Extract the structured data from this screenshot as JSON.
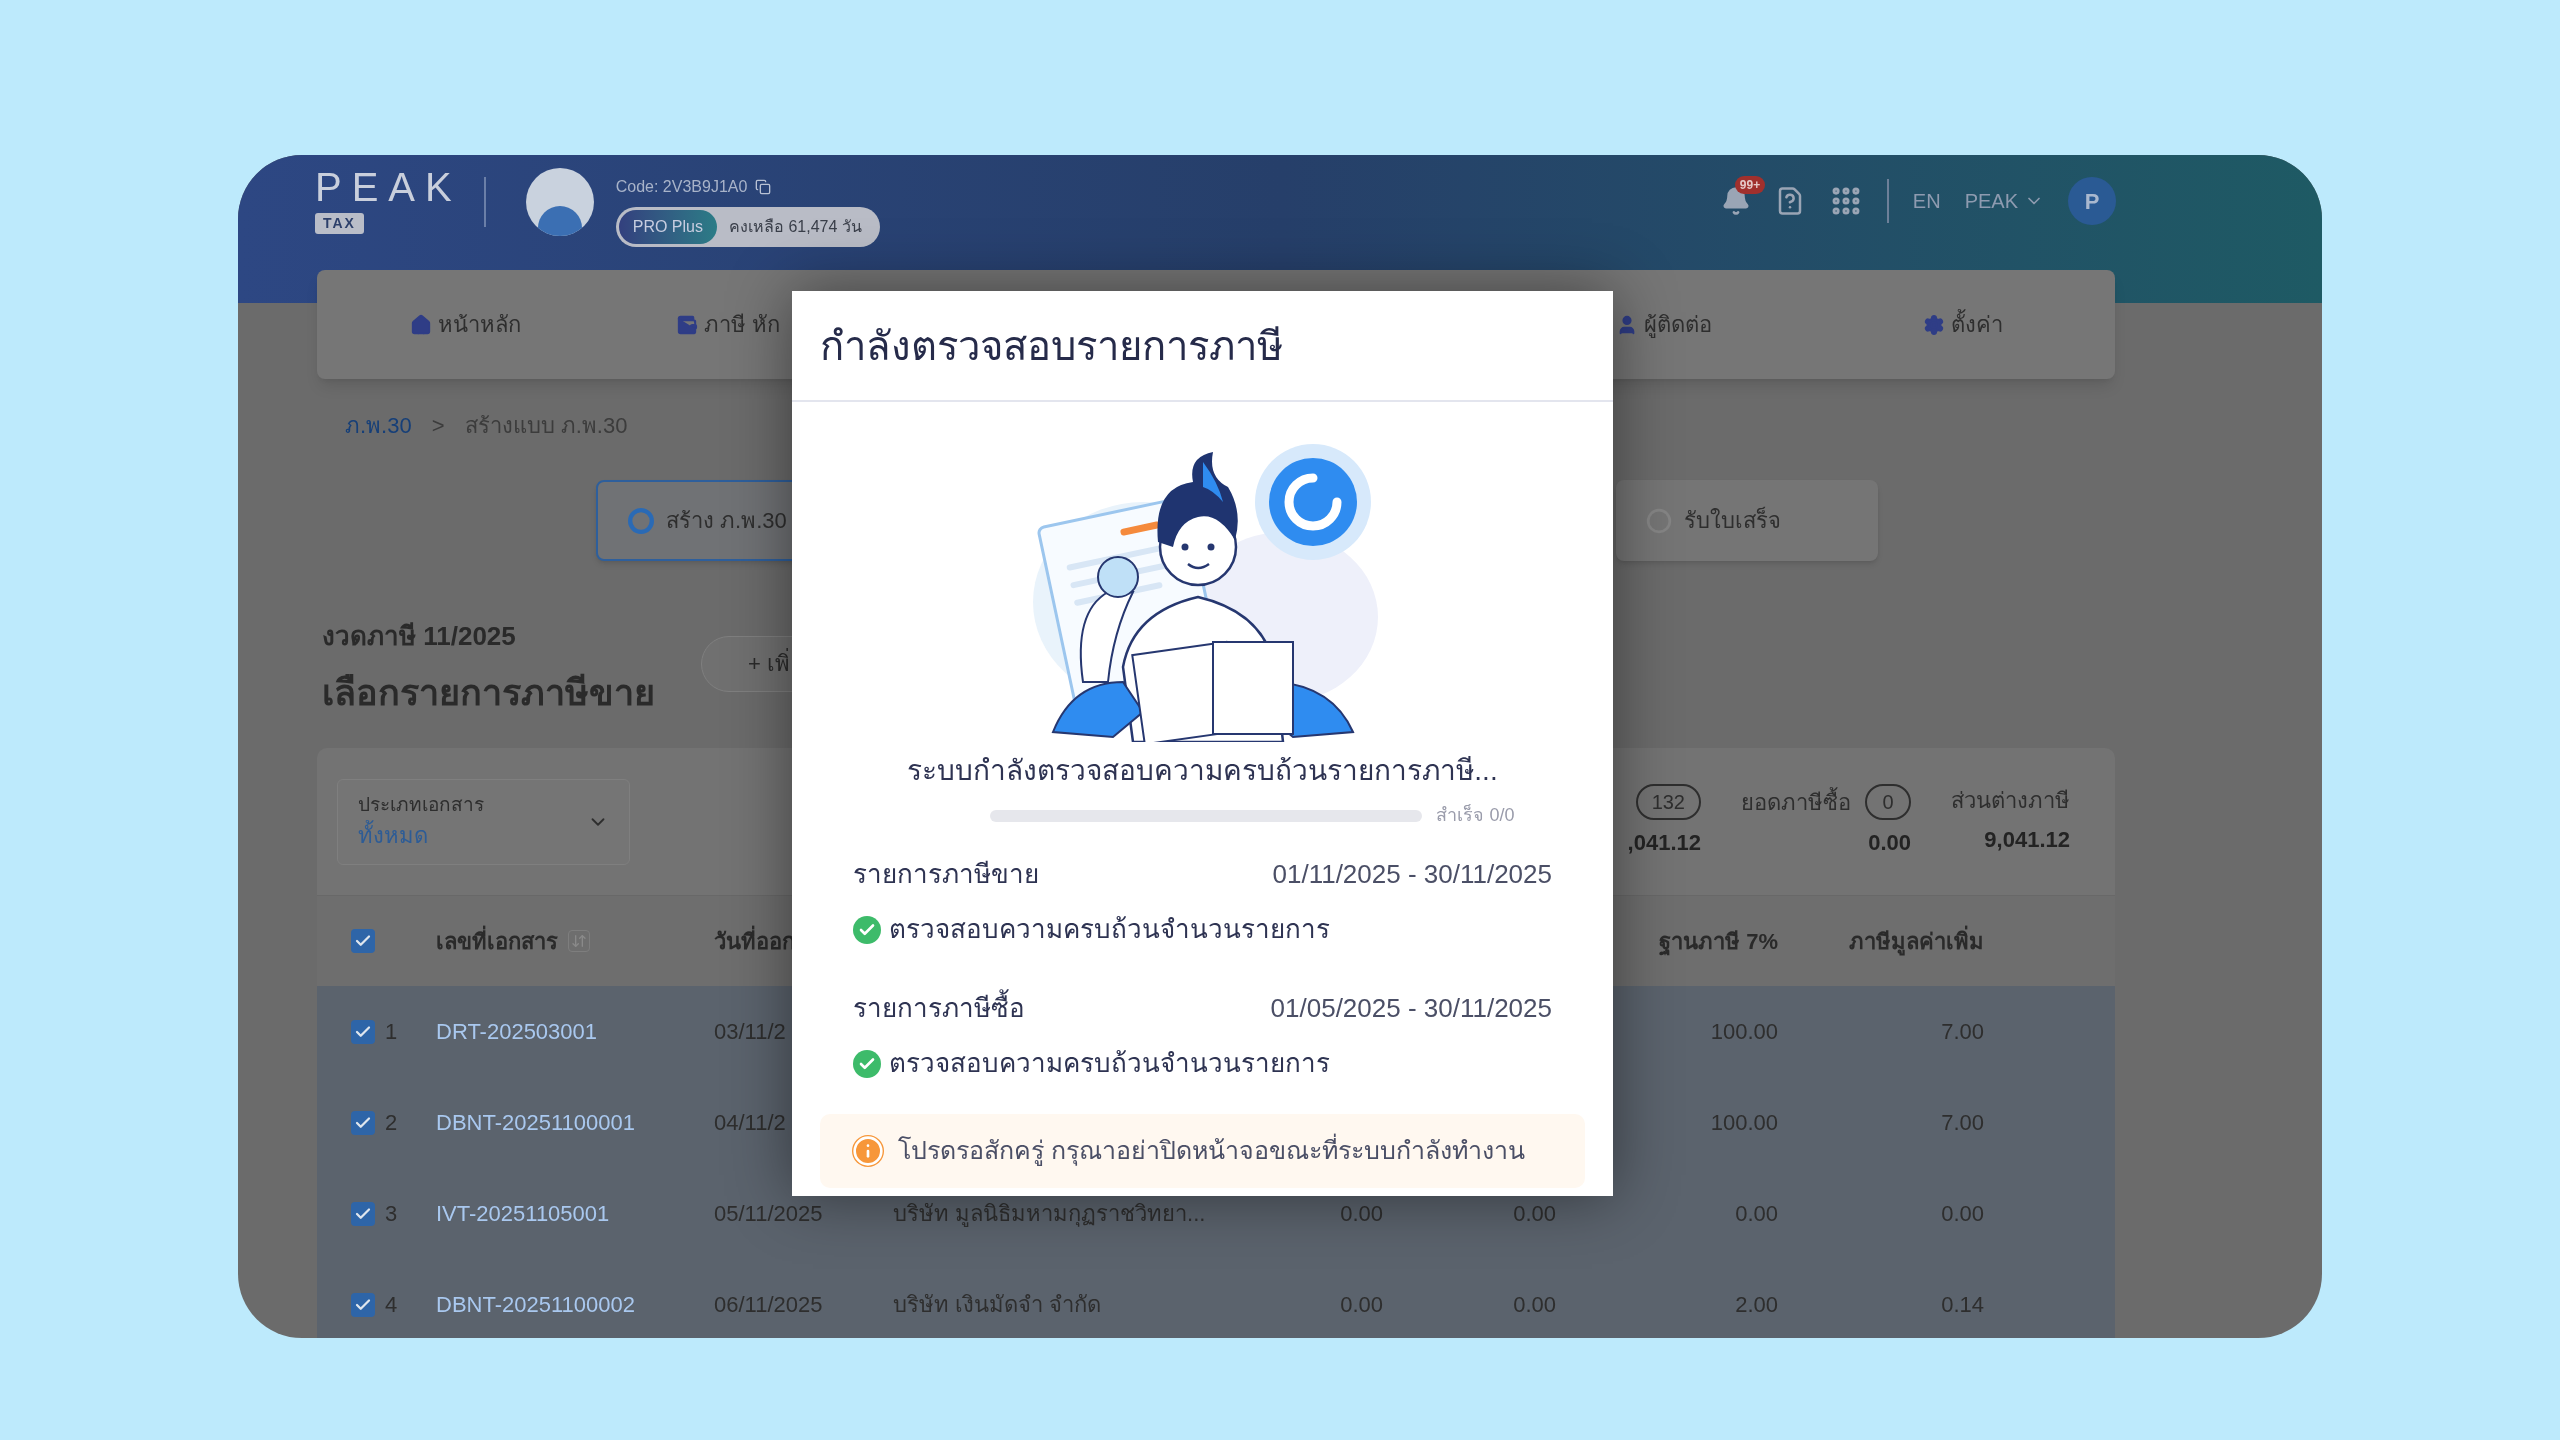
{
  "header": {
    "logo": "PEAK",
    "logo_badge": "TAX",
    "company_code": "Code: 2V3B9J1A0",
    "plan": "PRO Plus",
    "remaining": "คงเหลือ 61,474 วัน",
    "notifications": "99+",
    "language": "EN",
    "account": "PEAK",
    "avatar_initial": "P"
  },
  "nav": [
    {
      "label": "หน้าหลัก"
    },
    {
      "label": "ภาษี หัก"
    },
    {
      "label": "ผู้ติดต่อ"
    },
    {
      "label": "ตั้งค่า"
    }
  ],
  "breadcrumb": {
    "items": [
      "ภ.พ.30",
      "สร้างแบบ ภ.พ.30"
    ],
    "separator": ">"
  },
  "steps": [
    {
      "label": "สร้าง ภ.พ.30",
      "active": true
    },
    {
      "label": "รับใบเสร็จ",
      "active": false
    }
  ],
  "period": "งวดภาษี 11/2025",
  "heading": "เลือกรายการภาษีขาย",
  "add_button": "+ เพิ่",
  "filter": {
    "label": "ประเภทเอกสาร",
    "value": "ทั้งหมด"
  },
  "summary": [
    {
      "count": "132",
      "amount": ",041.12"
    },
    {
      "label": "ยอดภาษีซื้อ",
      "count": "0",
      "amount": "0.00"
    },
    {
      "label": "ส่วนต่างภาษี",
      "amount": "9,041.12"
    }
  ],
  "table": {
    "all_checked": true,
    "columns": {
      "document_no": "เลขที่เอกสาร",
      "issue_date": "วันที่ออก",
      "tax_base": "ฐานภาษี 7%",
      "vat": "ภาษีมูลค่าเพิ่ม"
    },
    "rows": [
      {
        "checked": true,
        "index": "1",
        "document_no": "DRT-202503001",
        "issue_date": "03/11/2",
        "tax_base": "100.00",
        "vat": "7.00"
      },
      {
        "checked": true,
        "index": "2",
        "document_no": "DBNT-20251100001",
        "issue_date": "04/11/2",
        "tax_base": "100.00",
        "vat": "7.00"
      },
      {
        "checked": true,
        "index": "3",
        "document_no": "IVT-20251105001",
        "issue_date": "05/11/2025",
        "company": "บริษัท มูลนิธิมหามกุฏราชวิทยา...",
        "column_5": "0.00",
        "column_6": "0.00",
        "tax_base": "0.00",
        "vat": "0.00"
      },
      {
        "checked": true,
        "index": "4",
        "document_no": "DBNT-20251100002",
        "issue_date": "06/11/2025",
        "company": "บริษัท เงินมัดจำ จำกัด",
        "column_5": "0.00",
        "column_6": "0.00",
        "tax_base": "2.00",
        "vat": "0.14"
      }
    ]
  },
  "modal": {
    "title": "กำลังตรวจสอบรายการภาษี",
    "status": "ระบบกำลังตรวจสอบความครบถ้วนรายการภาษี...",
    "progress": {
      "level": 0,
      "label": "สำเร็จ 0/0"
    },
    "sections": [
      {
        "title": "รายการภาษีขาย",
        "date_range": "01/11/2025 - 30/11/2025",
        "checks": [
          {
            "label": "ตรวจสอบความครบถ้วนจำนวนรายการ",
            "done": true
          }
        ]
      },
      {
        "title": "รายการภาษีซื้อ",
        "date_range": "01/05/2025 - 30/11/2025",
        "checks": [
          {
            "label": "ตรวจสอบความครบถ้วนจำนวนรายการ",
            "done": true
          }
        ]
      }
    ],
    "notice": "โปรดรอสักครู่ กรุณาอย่าปิดหน้าจอขณะที่ระบบกำลังทำงาน"
  }
}
